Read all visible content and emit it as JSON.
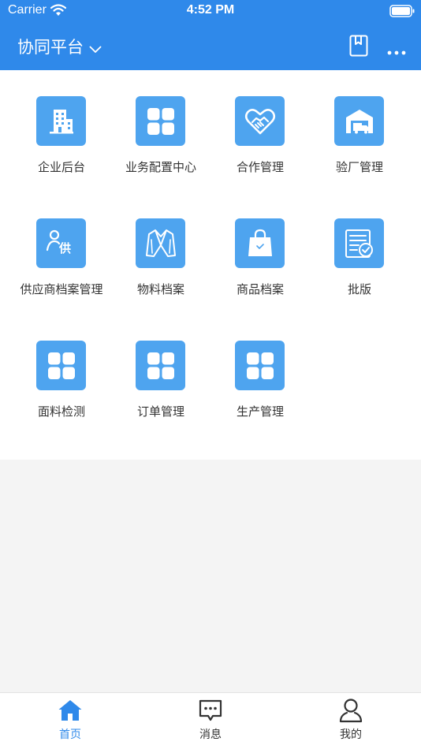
{
  "status_bar": {
    "carrier": "Carrier",
    "time": "4:52 PM"
  },
  "header": {
    "title": "协同平台"
  },
  "modules": [
    {
      "label": "企业后台",
      "icon": "building-icon"
    },
    {
      "label": "业务配置中心",
      "icon": "grid-icon"
    },
    {
      "label": "合作管理",
      "icon": "handshake-heart-icon"
    },
    {
      "label": "验厂管理",
      "icon": "factory-truck-icon"
    },
    {
      "label": "供应商档案管理",
      "icon": "supplier-person-icon"
    },
    {
      "label": "物料档案",
      "icon": "jacket-icon"
    },
    {
      "label": "商品档案",
      "icon": "shopping-bag-icon"
    },
    {
      "label": "批版",
      "icon": "approved-document-icon"
    },
    {
      "label": "面料检测",
      "icon": "grid-icon"
    },
    {
      "label": "订单管理",
      "icon": "grid-icon"
    },
    {
      "label": "生产管理",
      "icon": "grid-icon"
    }
  ],
  "tabbar": {
    "items": [
      {
        "label": "首页",
        "icon": "home-icon",
        "active": true
      },
      {
        "label": "消息",
        "icon": "message-icon",
        "active": false
      },
      {
        "label": "我的",
        "icon": "user-icon",
        "active": false
      }
    ]
  },
  "colors": {
    "primary": "#2f89ea",
    "tile": "#4ea4ef",
    "background": "#f4f4f4"
  }
}
